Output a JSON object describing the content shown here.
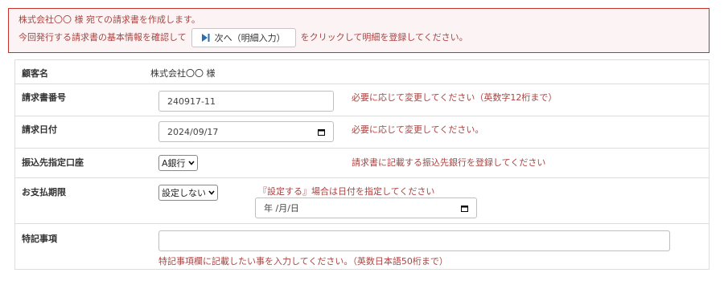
{
  "notice": {
    "line1": "株式会社〇〇 様 宛ての請求書を作成します。",
    "line2_before": "今回発行する請求書の基本情報を確認して",
    "next_button_label": "次へ（明細入力）",
    "line2_after": "をクリックして明細を登録してください。"
  },
  "form": {
    "customer": {
      "label": "顧客名",
      "value": "株式会社〇〇 様"
    },
    "invoice_number": {
      "label": "請求書番号",
      "value": "240917-11",
      "hint": "必要に応じて変更してください（英数字12桁まで）"
    },
    "invoice_date": {
      "label": "請求日付",
      "value": "2024/09/17",
      "hint": "必要に応じて変更してください。"
    },
    "bank_account": {
      "label": "振込先指定口座",
      "selected": "A銀行",
      "hint": "請求書に記載する振込先銀行を登録してください"
    },
    "payment_due": {
      "label": "お支払期限",
      "selected": "設定しない",
      "hint": "『設定する』場合は日付を指定してください",
      "date_placeholder": "年 /月/日"
    },
    "remarks": {
      "label": "特記事項",
      "value": "",
      "hint": "特記事項欄に記載したい事を入力してください。（英数日本語50桁まで）"
    }
  },
  "colors": {
    "accent_red": "#a94442",
    "border_red": "#c9302c"
  }
}
